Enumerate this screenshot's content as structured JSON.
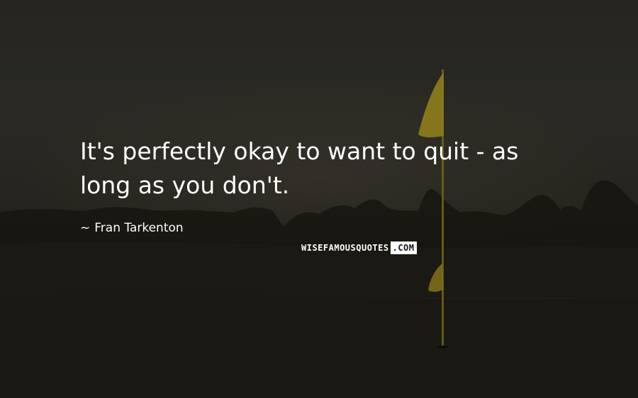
{
  "quote": {
    "text": "It's perfectly okay to want to quit - as long as you don't.",
    "author_prefix": "~",
    "author": "Fran Tarkenton"
  },
  "watermark": {
    "main": "WISEFAMOUSQUOTES",
    "tld": ".COM"
  },
  "colors": {
    "text": "#ffffff",
    "flag": "#8a7a1c",
    "background": "#1b1a16"
  }
}
